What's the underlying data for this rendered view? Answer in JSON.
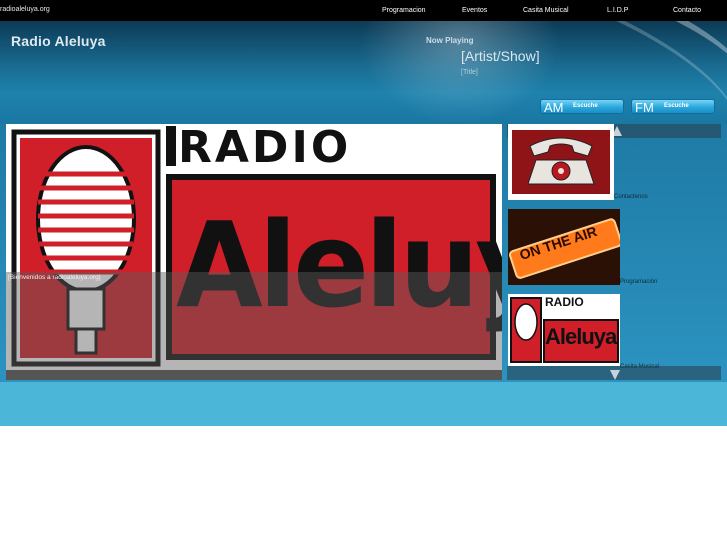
{
  "site": {
    "domain": "radioaleluya.org"
  },
  "nav": {
    "items": [
      {
        "label": "Programacion"
      },
      {
        "label": "Eventos"
      },
      {
        "label": "Casita Musical"
      },
      {
        "label": "L.I.D.P"
      },
      {
        "label": "Contacto"
      }
    ]
  },
  "header": {
    "brand": "Radio Aleluya",
    "now_playing": "Now Playing",
    "artist_placeholder": "[Artist/Show]",
    "title_placeholder": "[Title]"
  },
  "buttons": {
    "am": {
      "band": "AM",
      "label": "Escuche"
    },
    "fm": {
      "band": "FM",
      "label": "Escuche"
    }
  },
  "slideshow": {
    "logo_top": "RADIO",
    "logo_main": "Aleluya",
    "caption": "[Bienvenidos a radioaleluya.org]"
  },
  "thumbnails": [
    {
      "label": "Contactenos",
      "icon": "telephone-icon"
    },
    {
      "label": "Programación",
      "image_text": "ON THE AIR"
    },
    {
      "label": "Casita Musical",
      "image_top": "RADIO",
      "image_main": "Aleluya"
    }
  ],
  "colors": {
    "brand_red": "#d11f2a",
    "accent_blue": "#2aa7dc",
    "nav_bg": "#000000",
    "footer_blue": "#4bb6d8"
  }
}
